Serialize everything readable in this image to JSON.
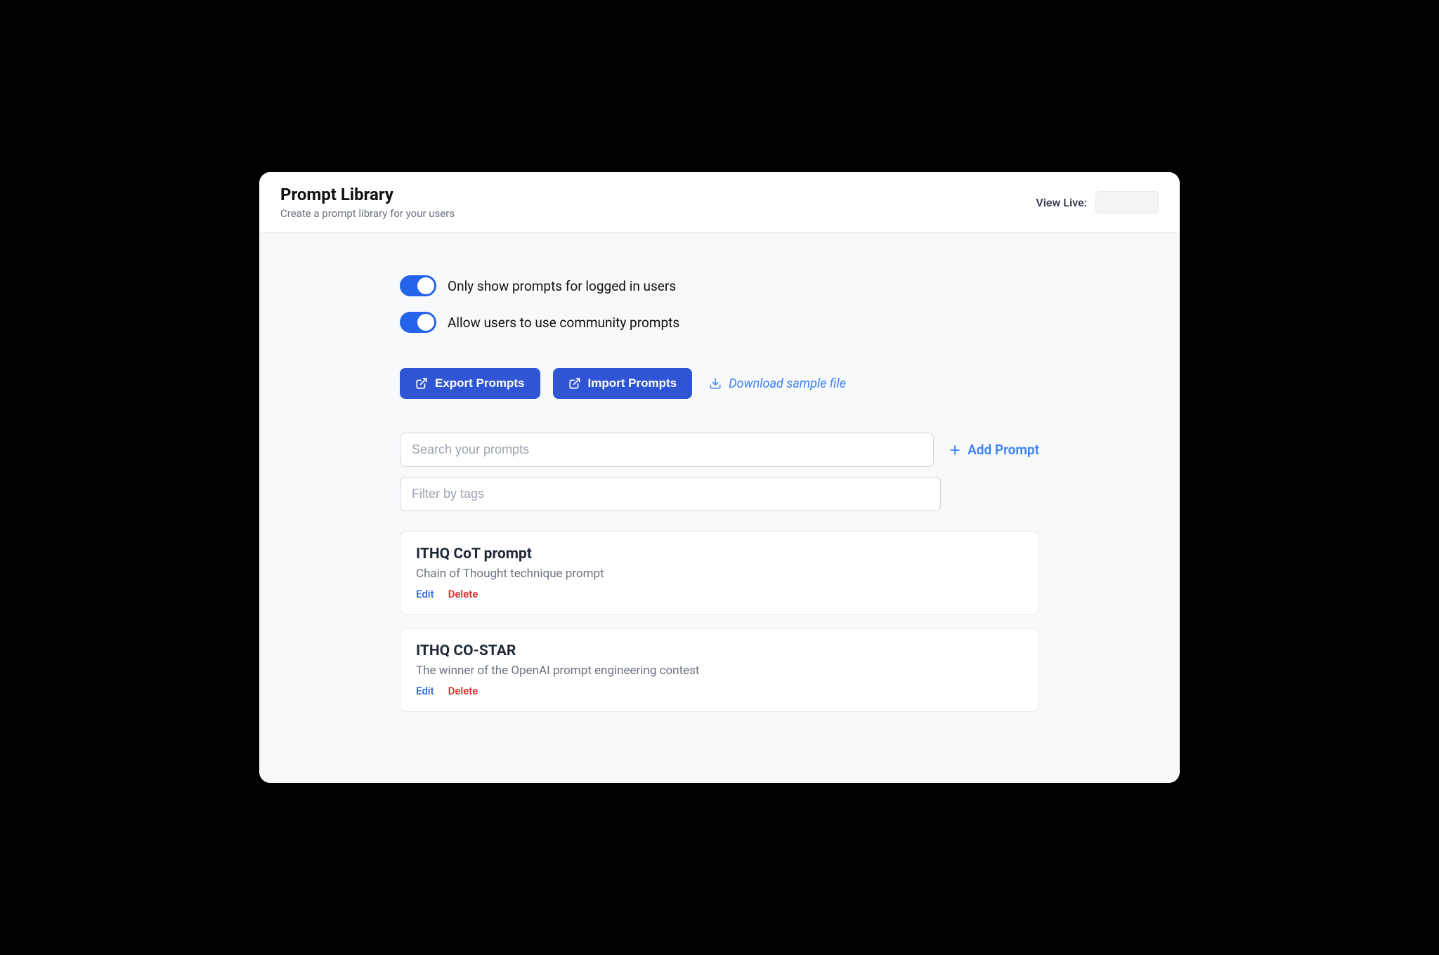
{
  "header": {
    "title": "Prompt Library",
    "subtitle": "Create a prompt library for your users",
    "view_live_label": "View Live:"
  },
  "toggles": {
    "logged_in": {
      "label": "Only show prompts for logged in users",
      "enabled": true
    },
    "community": {
      "label": "Allow users to use community prompts",
      "enabled": true
    }
  },
  "actions": {
    "export_label": "Export Prompts",
    "import_label": "Import Prompts",
    "download_sample_label": "Download sample file",
    "add_prompt_label": "Add Prompt"
  },
  "inputs": {
    "search_placeholder": "Search your prompts",
    "filter_placeholder": "Filter by tags"
  },
  "prompts": [
    {
      "title": "ITHQ CoT prompt",
      "description": "Chain of Thought technique prompt",
      "edit_label": "Edit",
      "delete_label": "Delete"
    },
    {
      "title": "ITHQ CO-STAR",
      "description": "The winner of the OpenAI prompt engineering contest",
      "edit_label": "Edit",
      "delete_label": "Delete"
    }
  ]
}
